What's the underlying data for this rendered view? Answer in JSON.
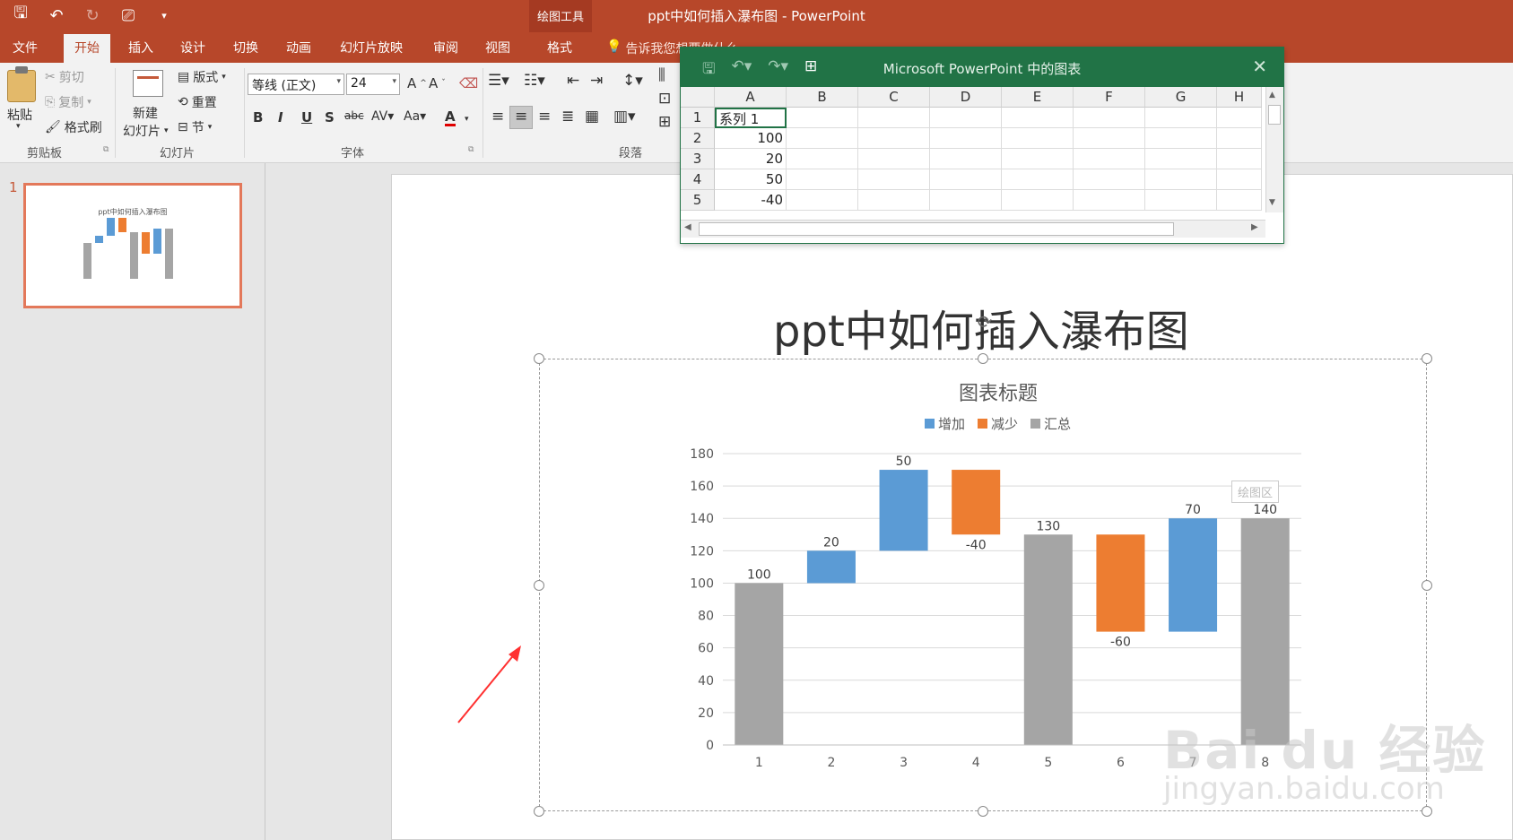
{
  "window": {
    "title": "ppt中如何插入瀑布图 - PowerPoint",
    "contextual_group": "绘图工具"
  },
  "tabs": [
    {
      "label": "文件"
    },
    {
      "label": "开始"
    },
    {
      "label": "插入"
    },
    {
      "label": "设计"
    },
    {
      "label": "切换"
    },
    {
      "label": "动画"
    },
    {
      "label": "幻灯片放映"
    },
    {
      "label": "审阅"
    },
    {
      "label": "视图"
    },
    {
      "label": "格式"
    }
  ],
  "active_tab": "开始",
  "tell_me": "告诉我您想要做什么",
  "ribbon": {
    "clipboard": {
      "paste": "粘贴",
      "cut": "剪切",
      "copy": "复制",
      "format_painter": "格式刷",
      "group": "剪贴板"
    },
    "slides": {
      "new_slide_line1": "新建",
      "new_slide_line2": "幻灯片",
      "layout": "版式",
      "reset": "重置",
      "section": "节",
      "group": "幻灯片"
    },
    "font": {
      "name": "等线 (正文)",
      "size": "24",
      "group": "字体"
    },
    "paragraph": {
      "group": "段落"
    }
  },
  "thumbnail": {
    "number": "1",
    "title": "ppt中如何插入瀑布图"
  },
  "slide": {
    "title": "ppt中如何插入瀑布图"
  },
  "excel": {
    "title": "Microsoft PowerPoint 中的图表",
    "columns": [
      "A",
      "B",
      "C",
      "D",
      "E",
      "F",
      "G",
      "H"
    ],
    "rows": [
      {
        "num": "1",
        "a": "系列 1"
      },
      {
        "num": "2",
        "a": "100"
      },
      {
        "num": "3",
        "a": "20"
      },
      {
        "num": "4",
        "a": "50"
      },
      {
        "num": "5",
        "a": "-40"
      }
    ]
  },
  "plot_area_tip": "绘图区",
  "colors": {
    "increase": "#5b9bd5",
    "decrease": "#ed7d31",
    "total": "#a5a5a5",
    "accent": "#b7472a"
  },
  "chart_data": {
    "type": "bar",
    "subtype": "waterfall",
    "title": "图表标题",
    "legend": [
      "增加",
      "减少",
      "汇总"
    ],
    "legend_position": "top",
    "categories": [
      "1",
      "2",
      "3",
      "4",
      "5",
      "6",
      "7",
      "8"
    ],
    "values": [
      100,
      20,
      50,
      -40,
      130,
      -60,
      70,
      140
    ],
    "kinds": [
      "total",
      "increase",
      "increase",
      "decrease",
      "total",
      "decrease",
      "increase",
      "total"
    ],
    "data_labels": [
      "100",
      "20",
      "50",
      "-40",
      "130",
      "-60",
      "70",
      "140"
    ],
    "ylim": [
      0,
      180
    ],
    "yticks": [
      0,
      20,
      40,
      60,
      80,
      100,
      120,
      140,
      160,
      180
    ],
    "grid": true
  },
  "watermark": {
    "brand": "Bai du 经验",
    "url": "jingyan.baidu.com"
  }
}
